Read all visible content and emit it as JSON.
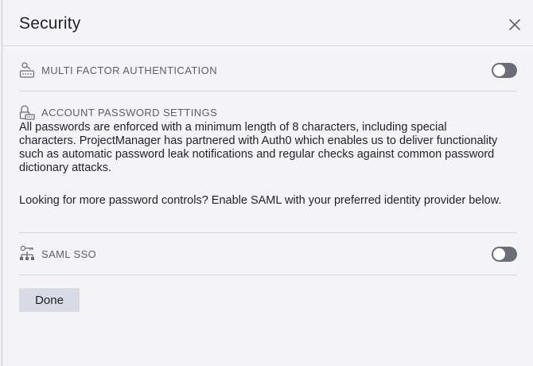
{
  "dialog": {
    "title": "Security",
    "close_icon": "close-icon"
  },
  "mfa": {
    "icon": "keyboard-key-icon",
    "label": "MULTI FACTOR AUTHENTICATION",
    "enabled": false
  },
  "password": {
    "icon": "lock-keyboard-icon",
    "label": "ACCOUNT PASSWORD SETTINGS",
    "description": "All passwords are enforced with a minimum length of 8 characters, including special characters. ProjectManager has partnered with Auth0 which enables us to deliver functionality such as automatic password leak notifications and regular checks against common password dictionary attacks.",
    "more_controls": "Looking for more password controls? Enable SAML with your preferred identity provider below."
  },
  "saml": {
    "icon": "network-hierarchy-icon",
    "label": "SAML SSO",
    "enabled": false
  },
  "footer": {
    "done_label": "Done"
  },
  "colors": {
    "toggle_off": "#6b6e76",
    "button_bg": "#d8dbe3",
    "background": "#f4f4f6"
  }
}
